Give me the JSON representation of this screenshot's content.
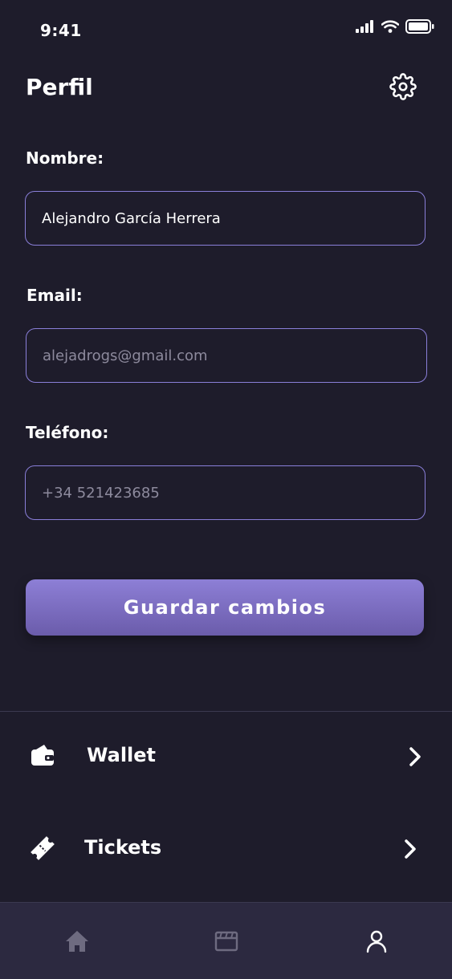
{
  "status_bar": {
    "time": "9:41"
  },
  "header": {
    "title": "Perfil",
    "settings_icon": "gear-icon"
  },
  "form": {
    "name": {
      "label": "Nombre:",
      "value": "Alejandro García Herrera"
    },
    "email": {
      "label": "Email:",
      "placeholder": "alejadrogs@gmail.com"
    },
    "phone": {
      "label": "Teléfono:",
      "placeholder": "+34 521423685"
    },
    "save_label": "Guardar cambios"
  },
  "menu": [
    {
      "label": "Wallet",
      "icon": "wallet-icon"
    },
    {
      "label": "Tickets",
      "icon": "ticket-icon"
    }
  ],
  "bottom_nav": [
    {
      "icon": "home-icon",
      "active": false
    },
    {
      "icon": "clapperboard-icon",
      "active": false
    },
    {
      "icon": "user-icon",
      "active": true
    }
  ],
  "colors": {
    "background": "#1e1c2b",
    "accent": "#8a7fd9",
    "nav_background": "#2c2940",
    "inactive_icon": "#6e6b80"
  }
}
